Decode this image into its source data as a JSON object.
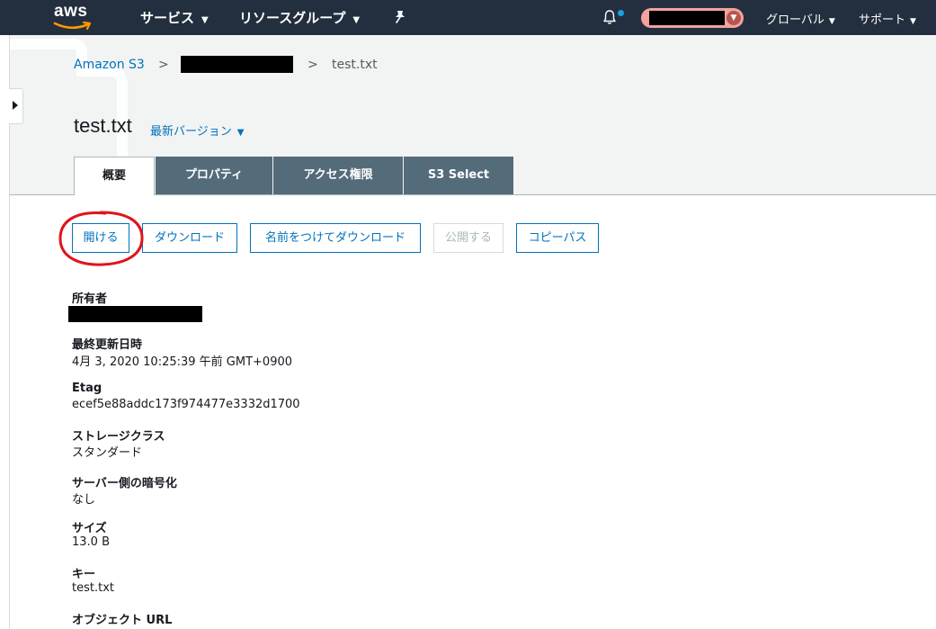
{
  "topnav": {
    "logo_text": "aws",
    "services": "サービス",
    "resource_groups": "リソースグループ",
    "icons": [
      "pin-icon",
      "bell-icon",
      "chevron-down-icon"
    ],
    "region": "グローバル",
    "support": "サポート",
    "notification_dot_color": "#1a9fe0",
    "account_badge_color": "#f2a39e"
  },
  "breadcrumb": {
    "root": "Amazon S3",
    "separator": ">",
    "current": "test.txt"
  },
  "object": {
    "title": "test.txt",
    "version_label": "最新バージョン"
  },
  "tabs": [
    {
      "label": "概要",
      "active": true
    },
    {
      "label": "プロパティ",
      "active": false
    },
    {
      "label": "アクセス権限",
      "active": false
    },
    {
      "label": "S3 Select",
      "active": false
    }
  ],
  "actions": {
    "open": "開ける",
    "download": "ダウンロード",
    "download_as": "名前をつけてダウンロード",
    "make_public": "公開する",
    "copy_path": "コピーパス",
    "highlight_color": "#e0141e"
  },
  "properties": {
    "owner_label": "所有者",
    "last_modified_label": "最終更新日時",
    "last_modified_value": "4月 3, 2020 10:25:39 午前 GMT+0900",
    "etag_label": "Etag",
    "etag_value": "ecef5e88addc173f974477e3332d1700",
    "storage_class_label": "ストレージクラス",
    "storage_class_value": "スタンダード",
    "encryption_label": "サーバー側の暗号化",
    "encryption_value": "なし",
    "size_label": "サイズ",
    "size_value": "13.0 B",
    "key_label": "キー",
    "key_value": "test.txt",
    "url_label": "オブジェクト URL"
  },
  "colors": {
    "nav_bg": "#232f3e",
    "link": "#0073bb",
    "tab_inactive": "#546b7a",
    "header_bg": "#f2f3f3"
  }
}
